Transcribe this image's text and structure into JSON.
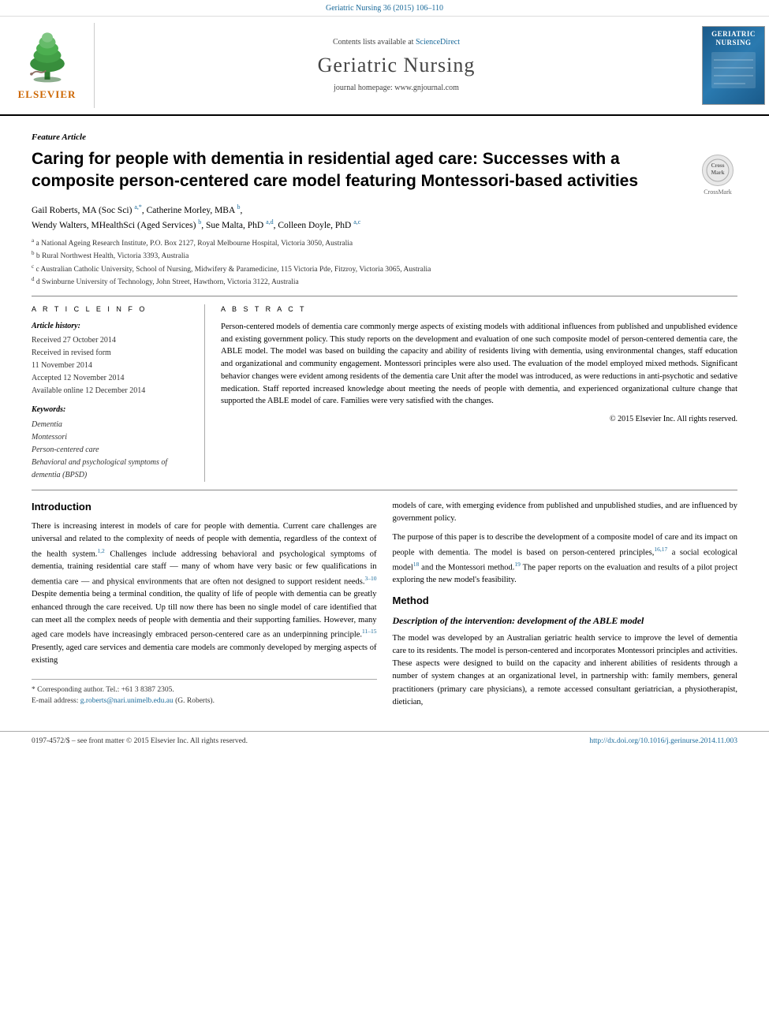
{
  "top_bar": {
    "text": "Geriatric Nursing 36 (2015) 106–110"
  },
  "header": {
    "contents_text": "Contents lists available at",
    "contents_link": "ScienceDirect",
    "journal_title": "Geriatric Nursing",
    "homepage_label": "journal homepage: www.gnjournal.com"
  },
  "article": {
    "feature_label": "Feature Article",
    "title": "Caring for people with dementia in residential aged care: Successes with a composite person-centered care model featuring Montessori-based activities",
    "authors": "Gail Roberts, MA (Soc Sci) a,*, Catherine Morley, MBA b, Wendy Walters, MHealthSci (Aged Services) b, Sue Malta, PhD a,d, Colleen Doyle, PhD a,c",
    "affiliations": [
      "a National Ageing Research Institute, P.O. Box 2127, Royal Melbourne Hospital, Victoria 3050, Australia",
      "b Rural Northwest Health, Victoria 3393, Australia",
      "c Australian Catholic University, School of Nursing, Midwifery & Paramedicine, 115 Victoria Pde, Fitzroy, Victoria 3065, Australia",
      "d Swinburne University of Technology, John Street, Hawthorn, Victoria 3122, Australia"
    ]
  },
  "article_info": {
    "section_label": "A R T I C L E   I N F O",
    "history_label": "Article history:",
    "received": "Received 27 October 2014",
    "received_revised": "Received in revised form",
    "received_revised_date": "11 November 2014",
    "accepted": "Accepted 12 November 2014",
    "available": "Available online 12 December 2014",
    "keywords_label": "Keywords:",
    "keywords": [
      "Dementia",
      "Montessori",
      "Person-centered care",
      "Behavioral and psychological symptoms of dementia (BPSD)"
    ]
  },
  "abstract": {
    "section_label": "A B S T R A C T",
    "text": "Person-centered models of dementia care commonly merge aspects of existing models with additional influences from published and unpublished evidence and existing government policy. This study reports on the development and evaluation of one such composite model of person-centered dementia care, the ABLE model. The model was based on building the capacity and ability of residents living with dementia, using environmental changes, staff education and organizational and community engagement. Montessori principles were also used. The evaluation of the model employed mixed methods. Significant behavior changes were evident among residents of the dementia care Unit after the model was introduced, as were reductions in anti-psychotic and sedative medication. Staff reported increased knowledge about meeting the needs of people with dementia, and experienced organizational culture change that supported the ABLE model of care. Families were very satisfied with the changes.",
    "copyright": "© 2015 Elsevier Inc. All rights reserved."
  },
  "introduction": {
    "heading": "Introduction",
    "paragraph1": "There is increasing interest in models of care for people with dementia. Current care challenges are universal and related to the complexity of needs of people with dementia, regardless of the context of the health system.1,2 Challenges include addressing behavioral and psychological symptoms of dementia, training residential care staff — many of whom have very basic or few qualifications in dementia care — and physical environments that are often not designed to support resident needs.3–10 Despite dementia being a terminal condition, the quality of life of people with dementia can be greatly enhanced through the care received. Up till now there has been no single model of care identified that can meet all the complex needs of people with dementia and their supporting families. However, many aged care models have increasingly embraced person-centered care as an underpinning principle.11–15 Presently, aged care services and dementia care models are commonly developed by merging aspects of existing"
  },
  "right_column": {
    "para1": "models of care, with emerging evidence from published and unpublished studies, and are influenced by government policy.",
    "para2": "The purpose of this paper is to describe the development of a composite model of care and its impact on people with dementia. The model is based on person-centered principles,16,17 a social ecological model18 and the Montessori method.19 The paper reports on the evaluation and results of a pilot project exploring the new model's feasibility.",
    "method_heading": "Method",
    "method_sub_heading": "Description of the intervention: development of the ABLE model",
    "method_para": "The model was developed by an Australian geriatric health service to improve the level of dementia care to its residents. The model is person-centered and incorporates Montessori principles and activities. These aspects were designed to build on the capacity and inherent abilities of residents through a number of system changes at an organizational level, in partnership with: family members, general practitioners (primary care physicians), a remote accessed consultant geriatrician, a physiotherapist, dietician,"
  },
  "footnotes": {
    "corresponding": "* Corresponding author. Tel.: +61 3 8387 2305.",
    "email_label": "E-mail address:",
    "email": "g.roberts@nari.unimelb.edu.au",
    "email_suffix": "(G. Roberts)."
  },
  "bottom": {
    "issn": "0197-4572/$ – see front matter © 2015 Elsevier Inc. All rights reserved.",
    "doi": "http://dx.doi.org/10.1016/j.gerinurse.2014.11.003"
  }
}
